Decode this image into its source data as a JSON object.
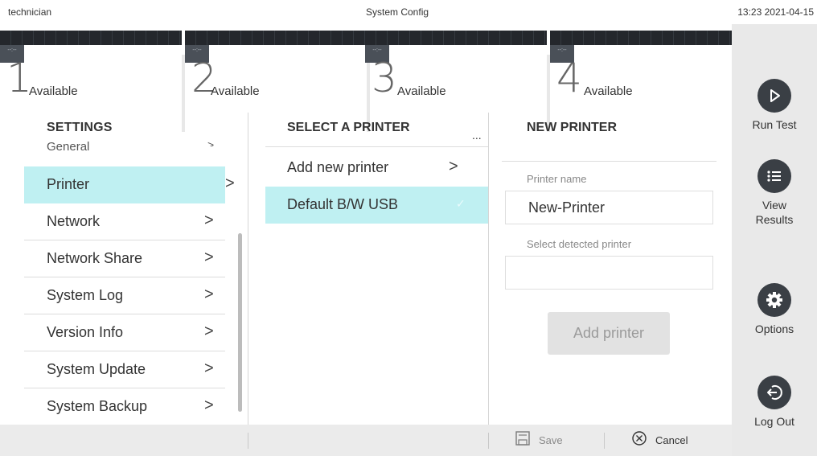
{
  "topbar": {
    "user": "technician",
    "title": "System Config",
    "datetime": "13:23 2021-04-15"
  },
  "slots": [
    {
      "number": "1",
      "status": "Available",
      "tag": "--:--"
    },
    {
      "number": "2",
      "status": "Available",
      "tag": "--:--"
    },
    {
      "number": "3",
      "status": "Available",
      "tag": "--:--"
    },
    {
      "number": "4",
      "status": "Available",
      "tag": "--:--"
    }
  ],
  "sidebar": {
    "run_test": "Run Test",
    "view_results": "View Results",
    "options": "Options",
    "log_out": "Log Out"
  },
  "settings": {
    "heading": "SETTINGS",
    "cut_item": "General",
    "items": [
      {
        "label": "Printer"
      },
      {
        "label": "Network"
      },
      {
        "label": "Network Share"
      },
      {
        "label": "System Log"
      },
      {
        "label": "Version Info"
      },
      {
        "label": "System Update"
      },
      {
        "label": "System Backup"
      }
    ],
    "chevron": ">"
  },
  "printer_list": {
    "heading": "SELECT A PRINTER",
    "more": "...",
    "add_new": "Add new printer",
    "default": "Default B/W USB",
    "check": "✓"
  },
  "new_printer": {
    "heading": "NEW PRINTER",
    "name_label": "Printer name",
    "name_value": "New-Printer",
    "detect_label": "Select detected printer",
    "detect_value": "",
    "add_button": "Add printer"
  },
  "bottombar": {
    "save": "Save",
    "cancel": "Cancel"
  },
  "colors": {
    "selection": "#bff0f2",
    "dark_icon": "#3a3f45",
    "sidebar_bg": "#e9e9e9"
  }
}
